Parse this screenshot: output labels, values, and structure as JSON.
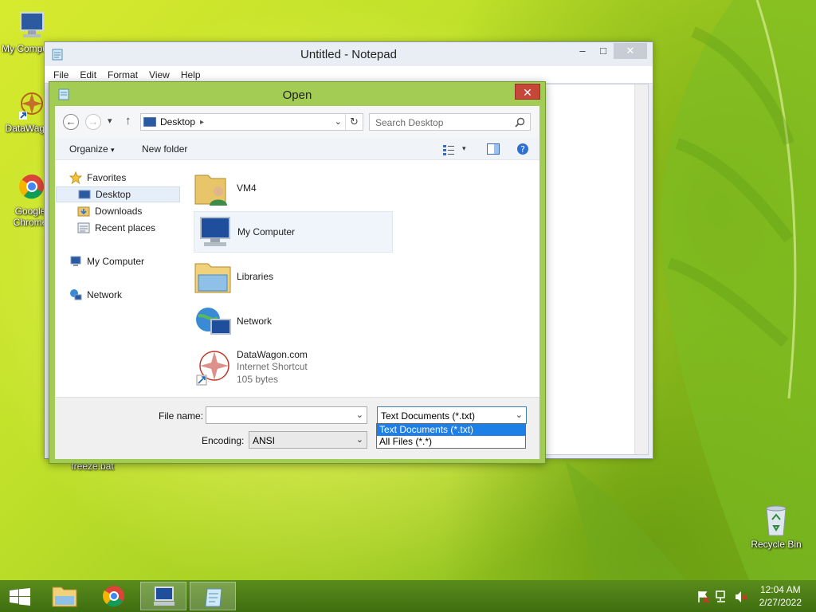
{
  "desktop": {
    "icons": [
      {
        "label": "My Computer"
      },
      {
        "label": "DataWagon"
      },
      {
        "label": "Google Chrome"
      },
      {
        "label": "freeze.bat"
      },
      {
        "label": "Recycle Bin"
      }
    ]
  },
  "notepad": {
    "title": "Untitled - Notepad",
    "menu": [
      "File",
      "Edit",
      "Format",
      "View",
      "Help"
    ],
    "controls": {
      "minimize": "–",
      "maximize": "□",
      "close": "✕"
    }
  },
  "dialog": {
    "title": "Open",
    "close": "✕",
    "nav": {
      "back": "←",
      "forward": "→",
      "recent": "▾",
      "up": "↑"
    },
    "address": "Desktop",
    "search_placeholder": "Search Desktop",
    "toolbar": {
      "organize": "Organize",
      "new_folder": "New folder"
    },
    "navpane": {
      "favorites": "Favorites",
      "items": [
        "Desktop",
        "Downloads",
        "Recent places"
      ],
      "my_computer": "My Computer",
      "network": "Network"
    },
    "files": [
      {
        "name": "VM4"
      },
      {
        "name": "My Computer"
      },
      {
        "name": "Libraries"
      },
      {
        "name": "Network"
      },
      {
        "name": "DataWagon.com",
        "type": "Internet Shortcut",
        "size": "105 bytes"
      }
    ],
    "bottom": {
      "file_name_label": "File name:",
      "file_name_value": "",
      "file_type_value": "Text Documents (*.txt)",
      "encoding_label": "Encoding:",
      "encoding_value": "ANSI",
      "file_type_options": [
        "Text Documents (*.txt)",
        "All Files  (*.*)"
      ]
    }
  },
  "taskbar": {
    "time": "12:04 AM",
    "date": "2/27/2022"
  }
}
